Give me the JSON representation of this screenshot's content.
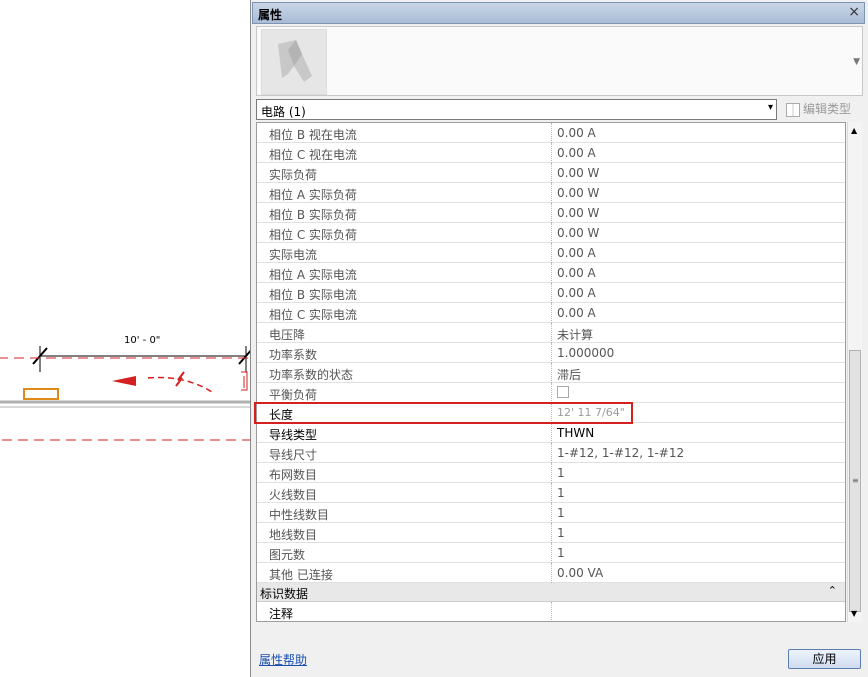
{
  "canvas": {
    "dimension_label": "10' - 0\""
  },
  "panel": {
    "title": "属性",
    "close_label": "×",
    "type_selector": {
      "value": "电路 (1)",
      "arrow": "▾"
    },
    "edit_type_label": "编辑类型",
    "rows": [
      {
        "name": "相位 B 视在电流",
        "value": "0.00 A"
      },
      {
        "name": "相位 C 视在电流",
        "value": "0.00 A"
      },
      {
        "name": "实际负荷",
        "value": "0.00 W"
      },
      {
        "name": "相位 A 实际负荷",
        "value": "0.00 W"
      },
      {
        "name": "相位 B 实际负荷",
        "value": "0.00 W"
      },
      {
        "name": "相位 C 实际负荷",
        "value": "0.00 W"
      },
      {
        "name": "实际电流",
        "value": "0.00 A"
      },
      {
        "name": "相位 A 实际电流",
        "value": "0.00 A"
      },
      {
        "name": "相位 B 实际电流",
        "value": "0.00 A"
      },
      {
        "name": "相位 C 实际电流",
        "value": "0.00 A"
      },
      {
        "name": "电压降",
        "value": "未计算"
      },
      {
        "name": "功率系数",
        "value": "1.000000"
      },
      {
        "name": "功率系数的状态",
        "value": "滞后"
      },
      {
        "name": "平衡负荷",
        "value": ""
      },
      {
        "name": "长度",
        "value": "12'  11 7/64\""
      },
      {
        "name": "导线类型",
        "value": "THWN"
      },
      {
        "name": "导线尺寸",
        "value": "1-#12, 1-#12, 1-#12"
      },
      {
        "name": "布网数目",
        "value": "1"
      },
      {
        "name": "火线数目",
        "value": "1"
      },
      {
        "name": "中性线数目",
        "value": "1"
      },
      {
        "name": "地线数目",
        "value": "1"
      },
      {
        "name": "图元数",
        "value": "1"
      },
      {
        "name": "其他 已连接",
        "value": "0.00 VA"
      }
    ],
    "section": {
      "title": "标识数据",
      "collapse_icon": "⌃"
    },
    "section_rows": [
      {
        "name": "注释",
        "value": ""
      }
    ],
    "help_link": "属性帮助",
    "apply_button": "应用"
  },
  "colors": {
    "highlight": "#d42020",
    "link": "#1a4fb0"
  }
}
